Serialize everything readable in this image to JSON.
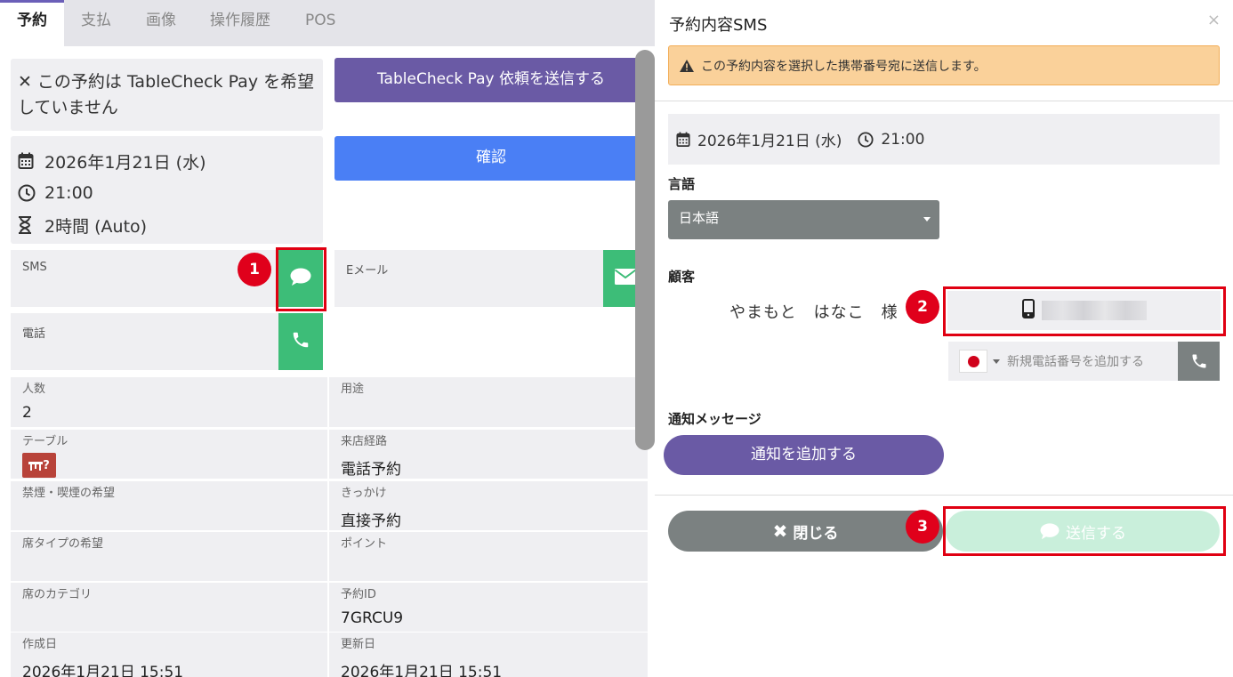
{
  "tabs": [
    {
      "label": "予約",
      "active": true
    },
    {
      "label": "支払",
      "active": false
    },
    {
      "label": "画像",
      "active": false
    },
    {
      "label": "操作履歴",
      "active": false
    },
    {
      "label": "POS",
      "active": false
    }
  ],
  "reservation": {
    "pay_status_text": "この予約は TableCheck Pay を希望していません",
    "pay_request_button": "TableCheck Pay 依頼を送信する",
    "confirm_button": "確認",
    "date": "2026年1月21日 (水)",
    "time": "21:00",
    "duration": "2時間 (Auto)"
  },
  "contact": {
    "sms_label": "SMS",
    "email_label": "Eメール",
    "phone_label": "電話"
  },
  "callouts": [
    "1",
    "2",
    "3"
  ],
  "details": [
    {
      "key": "人数",
      "value": "2"
    },
    {
      "key": "用途",
      "value": ""
    },
    {
      "key": "テーブル",
      "value": "",
      "badge": "?"
    },
    {
      "key": "来店経路",
      "value": "電話予約"
    },
    {
      "key": "禁煙・喫煙の希望",
      "value": ""
    },
    {
      "key": "きっかけ",
      "value": "直接予約"
    },
    {
      "key": "席タイプの希望",
      "value": ""
    },
    {
      "key": "ポイント",
      "value": ""
    },
    {
      "key": "席のカテゴリ",
      "value": ""
    },
    {
      "key": "予約ID",
      "value": "7GRCU9"
    },
    {
      "key": "作成日",
      "value": "2026年1月21日 15:51"
    },
    {
      "key": "更新日",
      "value": "2026年1月21日 15:51"
    }
  ],
  "sms_modal": {
    "title": "予約内容SMS",
    "close_symbol": "×",
    "alert": "この予約内容を選択した携帯番号宛に送信します。",
    "date": "2026年1月21日 (水)",
    "time": "21:00",
    "language_label": "言語",
    "language_value": "日本語",
    "customer_label": "顧客",
    "customer_name": "やまもと　はなこ　様",
    "new_phone_placeholder": "新規電話番号を追加する",
    "notification_label": "通知メッセージ",
    "add_notification_button": "通知を追加する",
    "close_button": "閉じる",
    "send_button": "送信する"
  },
  "colors": {
    "purple": "#6a5aa5",
    "blue": "#4a7ff5",
    "green": "#3dbd78",
    "callout_red": "#e0001b",
    "alert_bg": "#fad19a"
  }
}
